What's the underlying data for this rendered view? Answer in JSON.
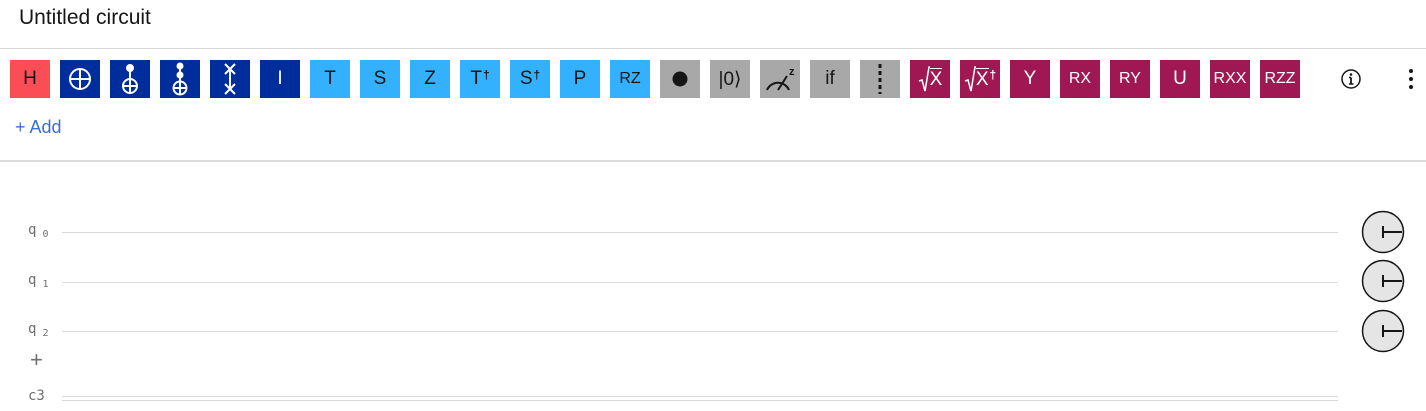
{
  "title": "Untitled circuit",
  "palette": {
    "gates": [
      {
        "id": "h",
        "label": "H",
        "color": "#fa4d56"
      },
      {
        "id": "cnot",
        "icon": "cnot-icon",
        "color": "#002d9c"
      },
      {
        "id": "ccx",
        "icon": "controlled-not-icon",
        "color": "#002d9c"
      },
      {
        "id": "ccx2",
        "icon": "toffoli-icon",
        "color": "#002d9c"
      },
      {
        "id": "swap",
        "icon": "swap-icon",
        "color": "#002d9c"
      },
      {
        "id": "i",
        "label": "I",
        "color": "#002d9c"
      },
      {
        "id": "t",
        "label": "T",
        "color": "#33b1ff"
      },
      {
        "id": "s",
        "label": "S",
        "color": "#33b1ff"
      },
      {
        "id": "z",
        "label": "Z",
        "color": "#33b1ff"
      },
      {
        "id": "tdg",
        "label": "T",
        "sup": "†",
        "color": "#33b1ff"
      },
      {
        "id": "sdg",
        "label": "S",
        "sup": "†",
        "color": "#33b1ff"
      },
      {
        "id": "p",
        "label": "P",
        "color": "#33b1ff"
      },
      {
        "id": "rz",
        "label": "RZ",
        "color": "#33b1ff"
      },
      {
        "id": "barrier-dot",
        "icon": "dot-icon",
        "color": "#a8a8a8"
      },
      {
        "id": "reset",
        "label": "|0⟩",
        "color": "#a8a8a8"
      },
      {
        "id": "measure",
        "icon": "measure-z-icon",
        "color": "#a8a8a8"
      },
      {
        "id": "if",
        "label": "if",
        "color": "#a8a8a8"
      },
      {
        "id": "barrier",
        "icon": "barrier-icon",
        "color": "#a8a8a8"
      },
      {
        "id": "sx",
        "label": "X",
        "icon": "sqrt-icon",
        "color": "#9f1853"
      },
      {
        "id": "sxdg",
        "label": "X",
        "sup": "†",
        "icon": "sqrt-icon",
        "color": "#9f1853"
      },
      {
        "id": "y",
        "label": "Y",
        "color": "#9f1853"
      },
      {
        "id": "rx",
        "label": "RX",
        "color": "#9f1853"
      },
      {
        "id": "ry",
        "label": "RY",
        "color": "#9f1853"
      },
      {
        "id": "u",
        "label": "U",
        "color": "#9f1853"
      },
      {
        "id": "rxx",
        "label": "RXX",
        "color": "#9f1853"
      },
      {
        "id": "rzz",
        "label": "RZZ",
        "color": "#9f1853"
      }
    ],
    "add_label": "+ Add"
  },
  "circuit": {
    "qubits": [
      {
        "name": "q",
        "index": "0"
      },
      {
        "name": "q",
        "index": "1"
      },
      {
        "name": "q",
        "index": "2"
      }
    ],
    "add_qubit_label": "+",
    "classical": {
      "name": "c3"
    }
  }
}
